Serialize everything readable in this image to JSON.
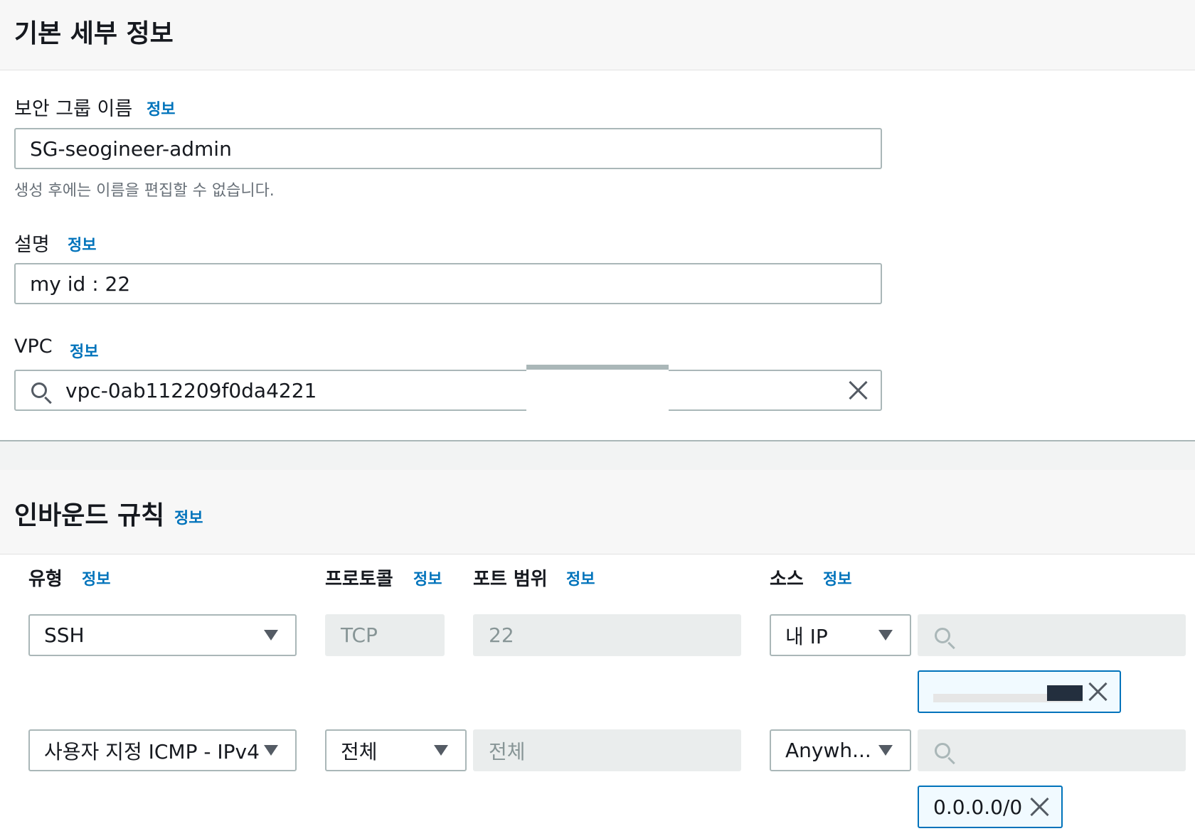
{
  "basic": {
    "title": "기본 세부 정보",
    "sg_name": {
      "label": "보안 그룹 이름",
      "info": "정보",
      "value": "SG-seogineer-admin",
      "hint": "생성 후에는 이름을 편집할 수 없습니다."
    },
    "description": {
      "label": "설명",
      "info": "정보",
      "value": "my id : 22"
    },
    "vpc": {
      "label": "VPC",
      "info": "정보",
      "value": "vpc-0ab112209f0da4221",
      "icon": "search-icon",
      "clear_icon": "close-icon"
    }
  },
  "inbound": {
    "title": "인바운드 규칙",
    "info": "정보",
    "columns": {
      "type": {
        "label": "유형",
        "info": "정보"
      },
      "protocol": {
        "label": "프로토콜",
        "info": "정보"
      },
      "port": {
        "label": "포트 범위",
        "info": "정보"
      },
      "source": {
        "label": "소스",
        "info": "정보"
      }
    },
    "rules": [
      {
        "type": "SSH",
        "protocol": "TCP",
        "port": "22",
        "source_type": "내 IP",
        "source_search": "",
        "source_token": ""
      },
      {
        "type": "사용자 지정 ICMP - IPv4",
        "protocol": "전체",
        "port": "전체",
        "source_type": "Anywh...",
        "source_search": "",
        "source_token": "0.0.0.0/0"
      }
    ]
  },
  "colors": {
    "info_link": "#0073bb",
    "token_border": "#0073bb",
    "input_border": "#aab7b8",
    "disabled_bg": "#eaeded"
  }
}
